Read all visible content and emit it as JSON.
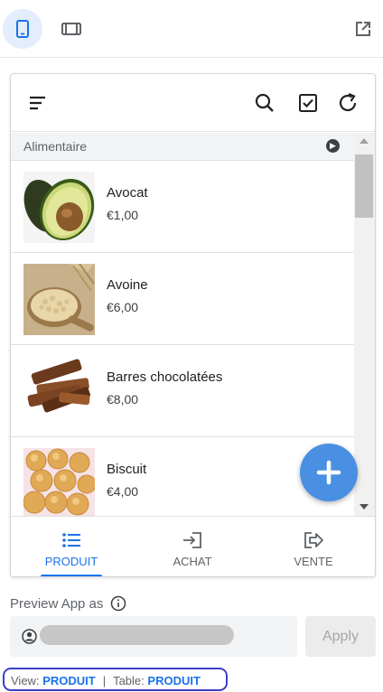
{
  "toolbar": {
    "mobile_icon": "phone-icon",
    "tablet_icon": "tablet-icon",
    "expand_icon": "open-external-icon"
  },
  "app": {
    "header_icons": [
      "menu-icon",
      "search-icon",
      "checkbox-icon",
      "refresh-icon"
    ],
    "group": {
      "label": "Alimentaire"
    },
    "items": [
      {
        "name": "Avocat",
        "price": "€1,00",
        "image": "avocado"
      },
      {
        "name": "Avoine",
        "price": "€6,00",
        "image": "oats"
      },
      {
        "name": "Barres chocolatées",
        "price": "€8,00",
        "image": "chocolate-bars"
      },
      {
        "name": "Biscuit",
        "price": "€4,00",
        "image": "biscuits"
      }
    ],
    "fab_icon": "plus-icon",
    "tabs": [
      {
        "label": "PRODUIT",
        "icon": "list-icon",
        "active": true
      },
      {
        "label": "ACHAT",
        "icon": "login-icon",
        "active": false
      },
      {
        "label": "VENTE",
        "icon": "forward-icon",
        "active": false
      }
    ]
  },
  "preview": {
    "label": "Preview App as",
    "user_value": "",
    "apply_label": "Apply"
  },
  "view_info": {
    "view_label": "View:",
    "view_value": "PRODUIT",
    "separator": "|",
    "table_label": "Table:",
    "table_value": "PRODUIT"
  },
  "colors": {
    "accent": "#1a73e8",
    "fab": "#4a90e2",
    "highlight_border": "#3b3ec7"
  }
}
